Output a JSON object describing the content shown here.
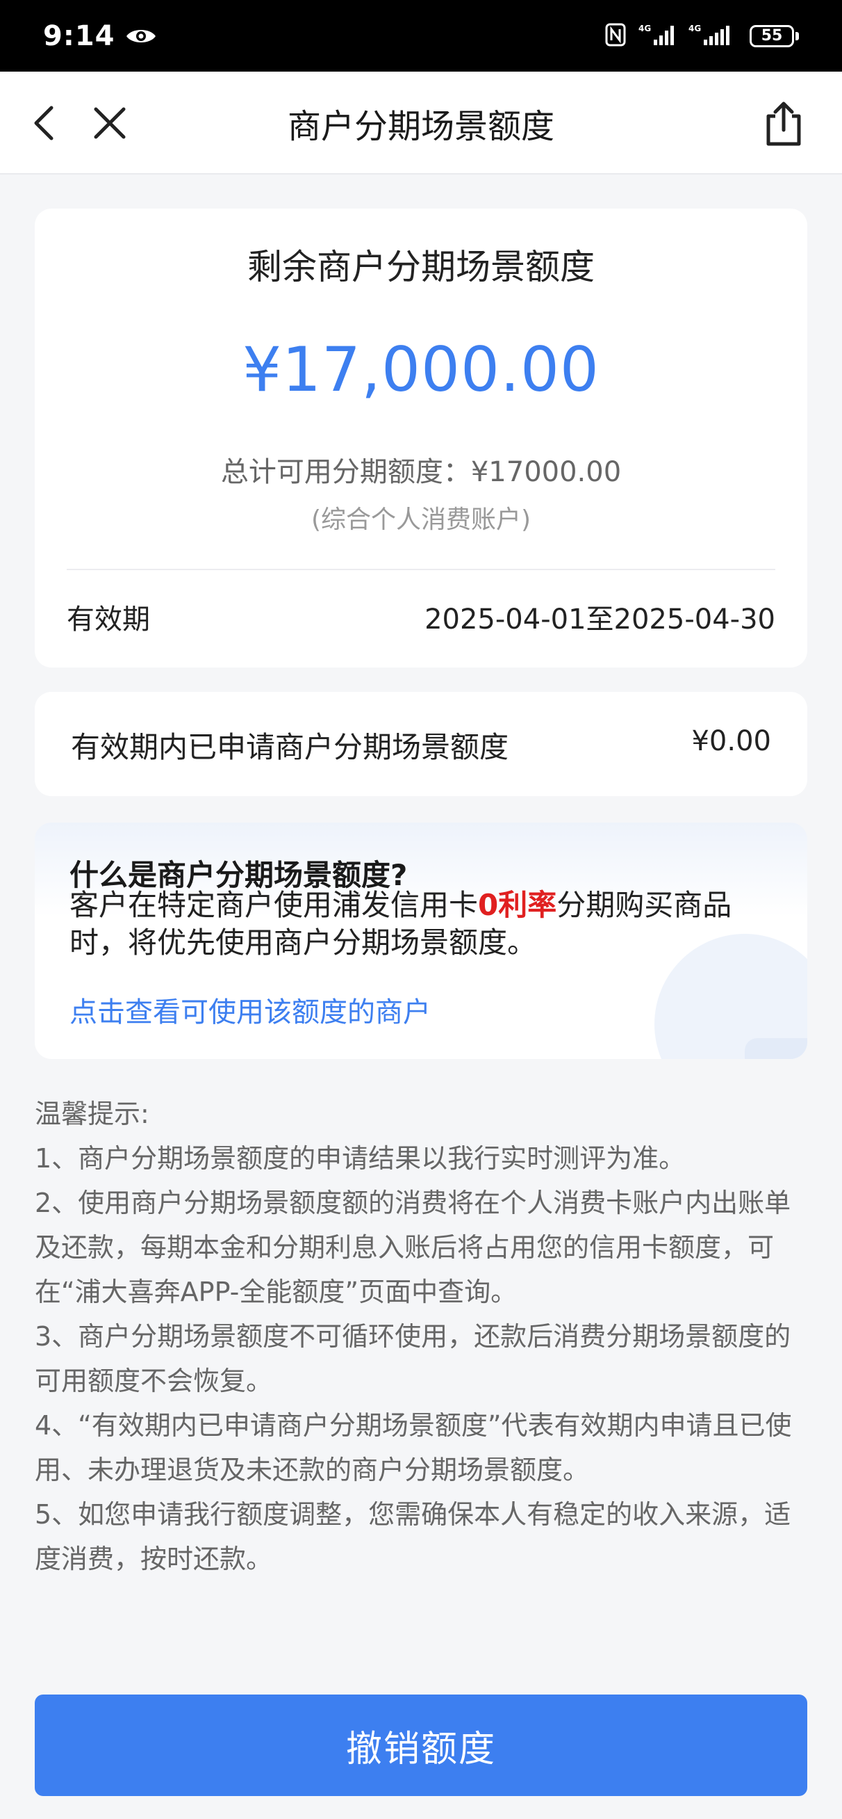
{
  "status_bar": {
    "time": "9:14",
    "network_1": "4G",
    "network_2": "4G",
    "battery": "55"
  },
  "nav": {
    "title": "商户分期场景额度"
  },
  "quota_card": {
    "title": "剩余商户分期场景额度",
    "amount": "¥17,000.00",
    "total_label": "总计可用分期额度：",
    "total_value": "¥17000.00",
    "note": "(综合个人消费账户)",
    "validity_label": "有效期",
    "validity_value": "2025-04-01至2025-04-30"
  },
  "applied_card": {
    "label": "有效期内已申请商户分期场景额度",
    "value": "¥0.00"
  },
  "info_card": {
    "title": "什么是商户分期场景额度?",
    "body_prefix": "客户在特定商户使用浦发信用卡",
    "body_highlight": "0利率",
    "body_suffix": "分期购买商品时，将优先使用商户分期场景额度。",
    "link": "点击查看可使用该额度的商户"
  },
  "tips": {
    "title": "温馨提示:",
    "items": [
      "1、商户分期场景额度的申请结果以我行实时测评为准。",
      "2、使用商户分期场景额度额的消费将在个人消费卡账户内出账单及还款，每期本金和分期利息入账后将占用您的信用卡额度，可在“浦大喜奔APP-全能额度”页面中查询。",
      "3、商户分期场景额度不可循环使用，还款后消费分期场景额度的可用额度不会恢复。",
      "4、“有效期内已申请商户分期场景额度”代表有效期内申请且已使用、未办理退货及未还款的商户分期场景额度。",
      "5、如您申请我行额度调整，您需确保本人有稳定的收入来源，适度消费，按时还款。"
    ]
  },
  "footer": {
    "button": "撤销额度"
  },
  "colors": {
    "accent": "#3d7ff0",
    "highlight": "#e02020"
  },
  "icons": [
    "eye-icon",
    "nfc-icon",
    "signal-icon",
    "battery-icon",
    "back-icon",
    "close-icon",
    "share-icon"
  ]
}
